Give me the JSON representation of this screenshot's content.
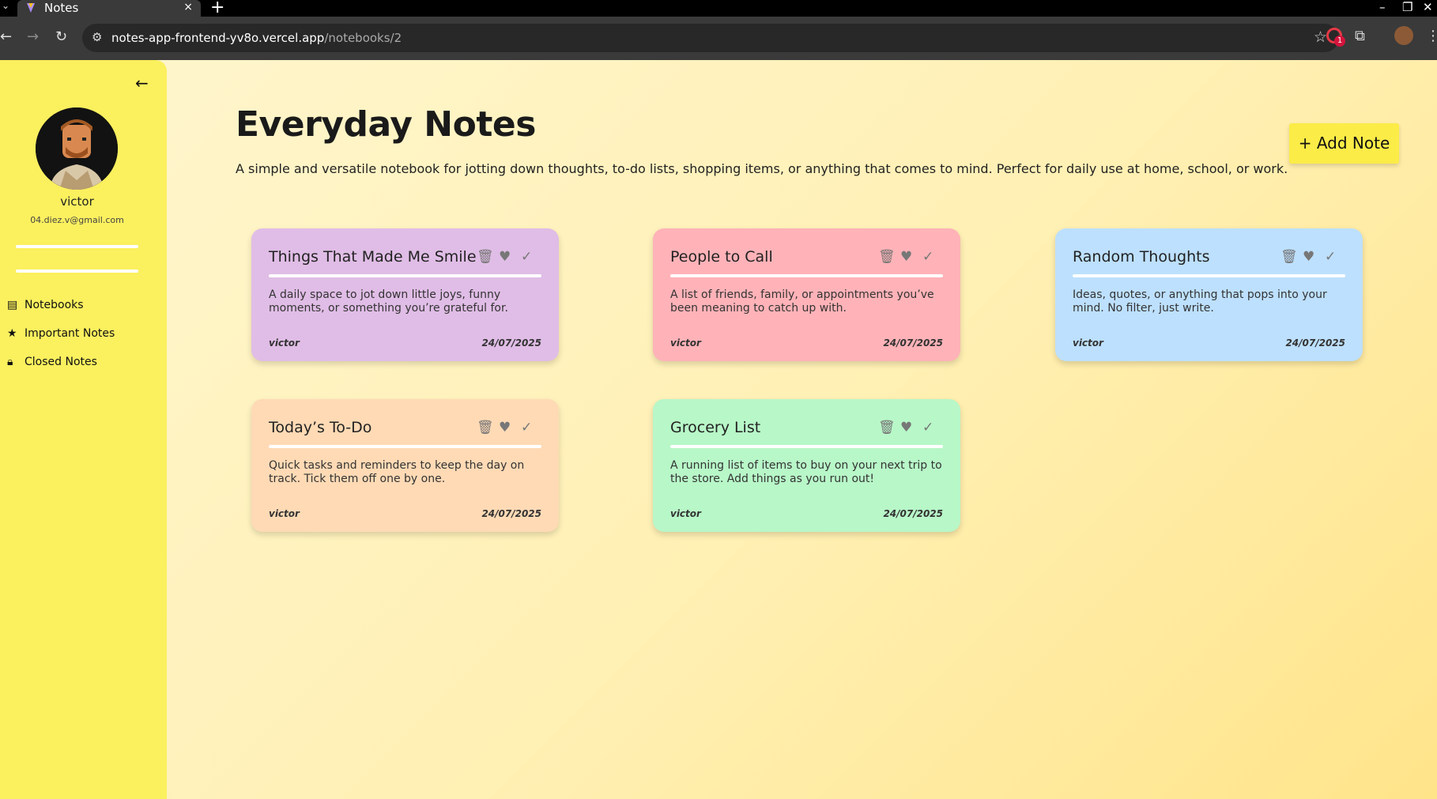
{
  "browser": {
    "tab_title": "Notes",
    "tab_close": "×",
    "new_tab": "+",
    "url_host": "notes-app-frontend-yv8o.vercel.app",
    "url_path": "/notebooks/2",
    "extension_badge": "1"
  },
  "sidebar": {
    "username": "victor",
    "email": "04.diez.v@gmail.com",
    "items": [
      {
        "label": "Notebooks",
        "icon": "book-icon"
      },
      {
        "label": "Important Notes",
        "icon": "star-icon"
      },
      {
        "label": "Closed Notes",
        "icon": "lock-icon"
      }
    ]
  },
  "notebook": {
    "title": "Everyday Notes",
    "description": "A simple and versatile notebook for jotting down thoughts, to-do lists, shopping items, or anything that comes to mind. Perfect for daily use at home, school, or work.",
    "add_note_label": "+ Add Note"
  },
  "notes": [
    {
      "title": "Things That Made Me Smile",
      "body": "A daily space to jot down little joys, funny moments, or something you’re grateful for.",
      "author": "victor",
      "date": "24/07/2025",
      "color": "#e0bde6"
    },
    {
      "title": "People to Call",
      "body": "A list of friends, family, or appointments you’ve been meaning to catch up with.",
      "author": "victor",
      "date": "24/07/2025",
      "color": "#ffb3b8"
    },
    {
      "title": "Random Thoughts",
      "body": "Ideas, quotes, or anything that pops into your mind. No filter, just write.",
      "author": "victor",
      "date": "24/07/2025",
      "color": "#bde0fe"
    },
    {
      "title": "Today’s To-Do",
      "body": "Quick tasks and reminders to keep the day on track. Tick them off one by one.",
      "author": "victor",
      "date": "24/07/2025",
      "color": "#ffdab5"
    },
    {
      "title": "Grocery List",
      "body": "A running list of items to buy on your next trip to the store. Add things as you run out!",
      "author": "victor",
      "date": "24/07/2025",
      "color": "#b8f7c8"
    }
  ],
  "colors": {
    "sidebar": "#fbf05e",
    "add_button": "#fbec47",
    "icon_gray": "#777777"
  }
}
